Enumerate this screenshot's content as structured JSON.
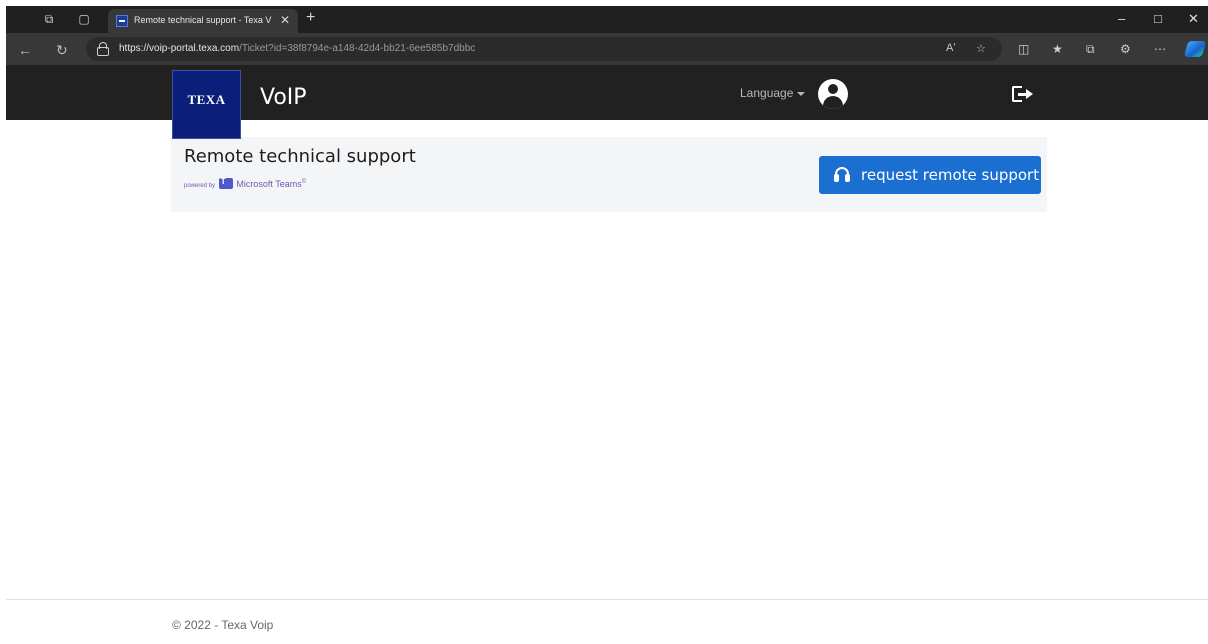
{
  "browser": {
    "tab_title": "Remote technical support - Texa V",
    "url_host": "https://voip-portal.texa.com",
    "url_path": "/Ticket?id=38f8794e-a148-42d4-bb21-6ee585b7dbbc",
    "read_aloud": "Aʹ"
  },
  "header": {
    "logo_text": "TEXA",
    "app_name": "VoIP",
    "language_label": "Language"
  },
  "card": {
    "title": "Remote technical support",
    "powered_by": "powered by",
    "teams_label": "Microsoft Teams",
    "teams_mark": "©",
    "button_label": "request remote support"
  },
  "footer": {
    "text": "© 2022 - Texa Voip"
  },
  "colors": {
    "header_bg": "#212121",
    "logo_bg": "#0b1f7a",
    "button_bg": "#1a6fd0",
    "card_bg": "#f4f5f7"
  }
}
